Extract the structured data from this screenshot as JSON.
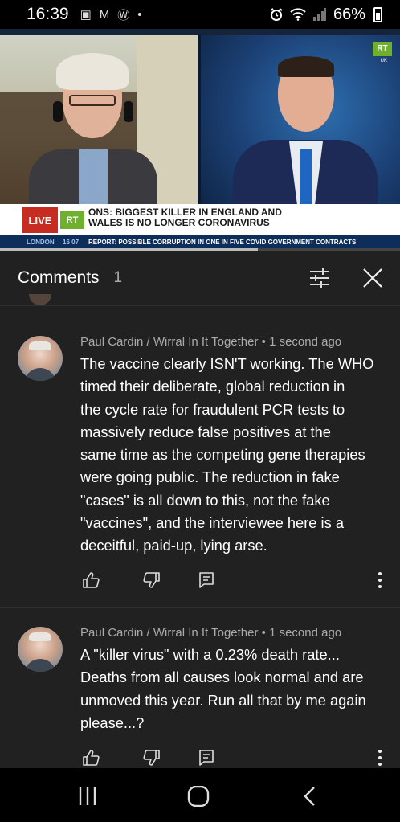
{
  "status_bar": {
    "time": "16:39",
    "battery": "66%",
    "left_icons": [
      "notification-icon",
      "gmail-icon",
      "wordpress-icon",
      "dot-icon"
    ]
  },
  "video": {
    "channel_logo": "RT",
    "channel_region": "UK",
    "live_label": "LIVE",
    "ticker_logo": "RT",
    "headline_line1": "ONS: BIGGEST KILLER IN ENGLAND AND",
    "headline_line2": "WALES IS NO LONGER CORONAVIRUS",
    "location": "LONDON",
    "clock": "16 07",
    "report": "REPORT: POSSIBLE CORRUPTION IN ONE IN FIVE COVID GOVERNMENT CONTRACTS",
    "progress_fraction": 0.645
  },
  "comments_panel": {
    "title": "Comments",
    "count": "1",
    "comments": [
      {
        "author_line": "Paul Cardin / Wirral In It Together • 1 second ago",
        "lines": [
          "The vaccine clearly ISN'T working. The WHO",
          "timed their deliberate, global reduction in",
          "the cycle rate for fraudulent PCR tests to",
          "massively reduce false positives at the",
          "same time as the competing gene therapies",
          "were going public. The reduction in fake",
          "\"cases\" is all down to this, not the fake",
          "\"vaccines\", and the interviewee here is a",
          "deceitful, paid-up, lying arse."
        ]
      },
      {
        "author_line": "Paul Cardin / Wirral In It Together • 1 second ago",
        "lines": [
          "A \"killer virus\" with a 0.23% death rate...",
          "Deaths from all causes look normal and are",
          "unmoved this year. Run all that by me again",
          "please...?"
        ]
      }
    ]
  },
  "icons": {
    "like": "thumbs-up-icon",
    "dislike": "thumbs-down-icon",
    "reply": "reply-icon",
    "more": "more-vert-icon",
    "filter": "filter-icon",
    "close": "close-icon",
    "nav_recents": "recents-icon",
    "nav_home": "home-icon",
    "nav_back": "back-icon"
  }
}
